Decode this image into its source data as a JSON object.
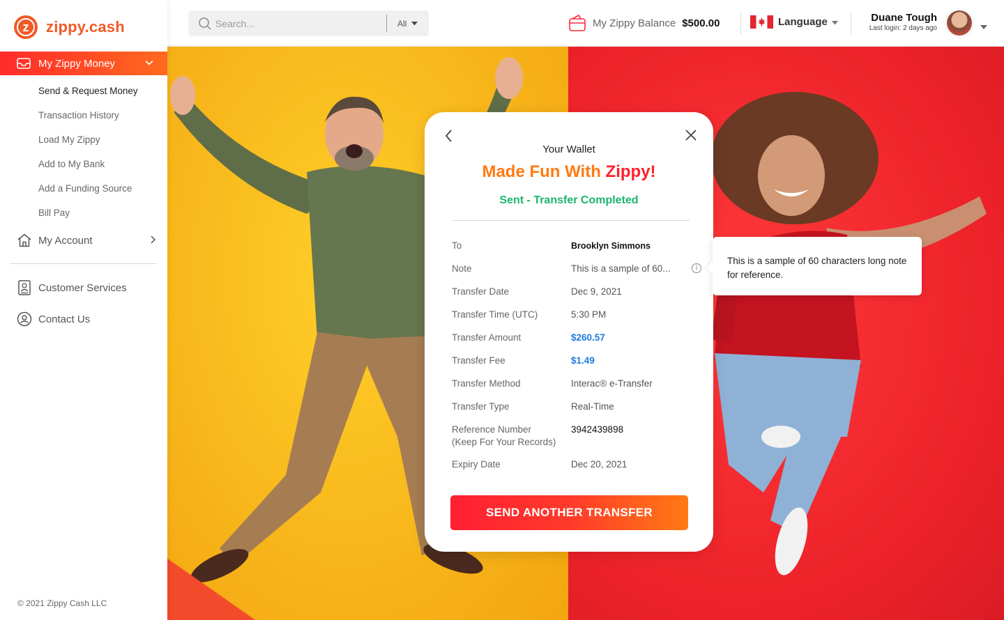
{
  "brand": {
    "logo_letter": "z",
    "name": "zippy.cash"
  },
  "sidebar": {
    "active_section": "My Zippy Money",
    "sub_items": [
      {
        "label": "Send & Request Money",
        "current": true
      },
      {
        "label": "Transaction History",
        "current": false
      },
      {
        "label": "Load My Zippy",
        "current": false
      },
      {
        "label": "Add to My Bank",
        "current": false
      },
      {
        "label": "Add a Funding Source",
        "current": false
      },
      {
        "label": "Bill Pay",
        "current": false
      }
    ],
    "my_account": "My Account",
    "customer_services": "Customer Services",
    "contact_us": "Contact Us",
    "copyright": "© 2021 Zippy Cash LLC"
  },
  "header": {
    "search_placeholder": "Search...",
    "search_filter": "All",
    "balance_label": "My Zippy Balance",
    "balance_amount": "$500.00",
    "language_label": "Language",
    "user_name": "Duane Tough",
    "last_login": "Last login: 2 days ago"
  },
  "modal": {
    "eyebrow": "Your Wallet",
    "headline_part1": "Made Fun With ",
    "headline_part2": "Zippy!",
    "status": "Sent - Transfer Completed",
    "rows": [
      {
        "label": "To",
        "value": "Brooklyn Simmons"
      },
      {
        "label": "Note",
        "value": "This is a sample of 60..."
      },
      {
        "label": "Transfer Date",
        "value": "Dec 9, 2021"
      },
      {
        "label": "Transfer Time (UTC)",
        "value": "5:30 PM"
      },
      {
        "label": "Transfer Amount",
        "value": "$260.57"
      },
      {
        "label": "Transfer Fee",
        "value": "$1.49"
      },
      {
        "label": "Transfer Method",
        "value": "Interac® e-Transfer"
      },
      {
        "label": "Transfer Type",
        "value": "Real-Time"
      },
      {
        "label": "Reference Number\n(Keep For Your Records)",
        "value": "3942439898"
      },
      {
        "label": "Expiry Date",
        "value": "Dec 20, 2021"
      }
    ],
    "info_glyph": "i",
    "cta": "SEND ANOTHER TRANSFER"
  },
  "tooltip": {
    "text": "This is a sample of 60 characters long note for reference."
  },
  "colors": {
    "brand_orange": "#f05a28",
    "cta_red": "#ff1f33",
    "cta_orange": "#ff7a14",
    "success_green": "#1db56b",
    "amount_blue": "#1f7ae0",
    "hero_yellow": "#f7b51a",
    "hero_red": "#ec2129"
  }
}
